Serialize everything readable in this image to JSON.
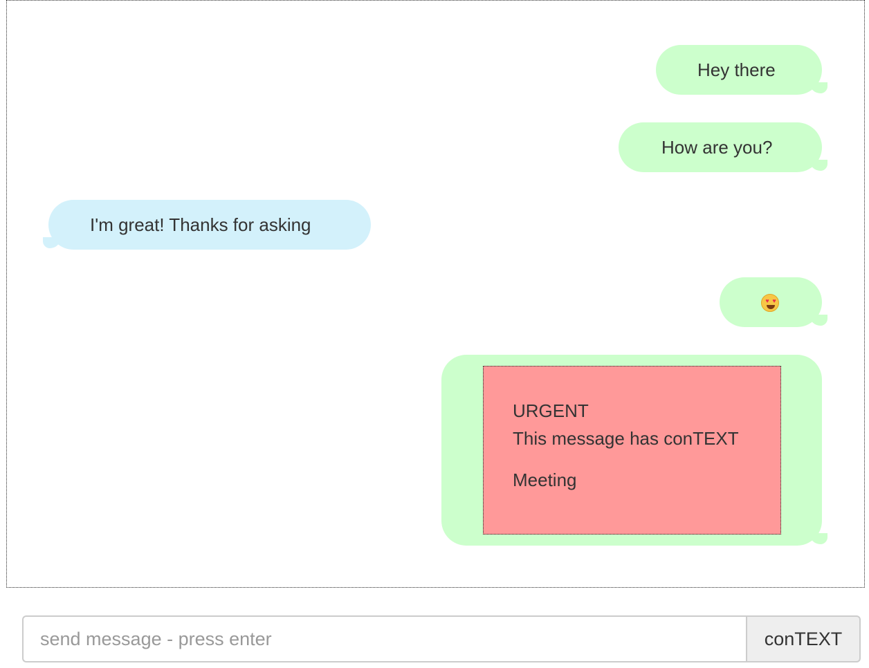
{
  "conversation": {
    "messages": [
      {
        "direction": "sent",
        "text": "Hey there"
      },
      {
        "direction": "sent",
        "text": "How are you?"
      },
      {
        "direction": "received",
        "text": "I'm great! Thanks for asking"
      },
      {
        "direction": "sent",
        "emoji": "heart-eyes-emoji"
      },
      {
        "direction": "sent",
        "context_card": {
          "priority": "URGENT",
          "description": "This message has conTEXT",
          "topic": "Meeting",
          "color": "#ff9999"
        }
      }
    ]
  },
  "composer": {
    "placeholder": "send message - press enter",
    "value": "",
    "button_label": "conTEXT"
  },
  "colors": {
    "sent_bubble": "#ccffcc",
    "received_bubble": "#d3f1fb",
    "context_card": "#ff9999"
  }
}
